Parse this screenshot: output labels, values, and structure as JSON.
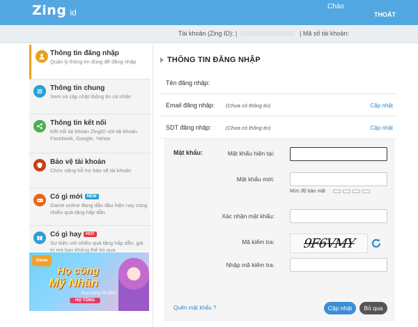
{
  "header": {
    "logo_main": "Zing",
    "logo_sub": "id",
    "greeting": "Chào",
    "logout": "THOÁT"
  },
  "account_bar": {
    "account_label": "Tài khoản (Zing ID): |",
    "account_number_label": "| Mã số tài khoản:"
  },
  "sidebar": {
    "items": [
      {
        "title": "Thông tin đăng nhập",
        "desc": "Quản lý thông tin dùng để đăng nhập",
        "icon": "person-icon",
        "color": "#e8a11a"
      },
      {
        "title": "Thông tin chung",
        "desc": "Xem và cập nhật thông tin cá nhân",
        "icon": "list-icon",
        "color": "#2a9fd6"
      },
      {
        "title": "Thông tin kết nối",
        "desc": "Kết nối tài khoản ZingID với tài khoản Facebook, Google, Yahoo",
        "icon": "share-icon",
        "color": "#4caf50"
      },
      {
        "title": "Bảo vệ tài khoản",
        "desc": "Chức năng hỗ trợ bảo vệ tài khoản",
        "icon": "shield-icon",
        "color": "#c2421a"
      },
      {
        "title": "Có gì mới",
        "badge": "NEW",
        "desc": "Game online đang dẫn đầu hiện nay cùng nhiều quà tặng hấp dẫn",
        "icon": "gamepad-icon",
        "color": "#e8651a"
      },
      {
        "title": "Có gì hay",
        "badge": "HOT",
        "desc": "Sự kiện với nhiều quà tặng hấp dẫn, giá trị mà bạn không thể bỏ qua",
        "icon": "gift-icon",
        "color": "#2a9fd6"
      }
    ],
    "badge_colors": {
      "NEW": "#2a9fd6",
      "HOT": "#e23c3c"
    }
  },
  "banner": {
    "title_line1": "Họ công",
    "title_line2": "Mỹ Nhân",
    "subtitle": "Đua Nàng Về Dinh",
    "button": "HỌ TỐNG"
  },
  "main": {
    "title": "THÔNG TIN ĐĂNG NHẬP",
    "rows": [
      {
        "label": "Tên đăng nhập:",
        "value": "",
        "link": ""
      },
      {
        "label": "Email đăng nhập:",
        "value": "(Chưa có thông tin)",
        "link": "Cập nhật"
      },
      {
        "label": "SDT đăng nhập:",
        "value": "(Chưa có thông tin)",
        "link": "Cập nhật"
      }
    ]
  },
  "password": {
    "section_label": "Mật khẩu:",
    "current_label": "Mật khẩu hiện tại:",
    "new_label": "Mật khẩu mới:",
    "strength_label": "Mức độ bảo mật",
    "confirm_label": "Xác nhận mật khẩu:",
    "captcha_label": "Mã kiểm tra:",
    "captcha_text": "9F6VMY",
    "captcha_input_label": "Nhập mã kiểm tra:",
    "current_value": "",
    "new_value": "",
    "confirm_value": "",
    "captcha_value": "",
    "forgot_link": "Quên mật khẩu ?",
    "update_button": "Cập nhật",
    "skip_button": "Bỏ qua"
  },
  "colors": {
    "header_bg": "#52a7e0",
    "link": "#2f86c5",
    "update_button": "#3b8fd6",
    "skip_button": "#555555"
  }
}
